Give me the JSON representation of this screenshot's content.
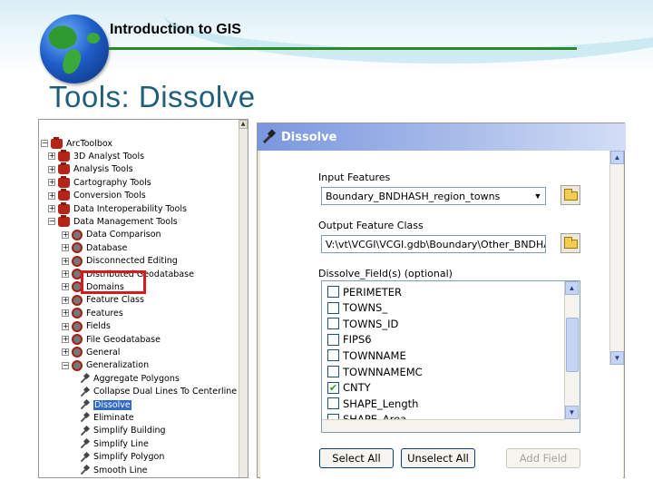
{
  "slide": {
    "course_title": "Introduction to GIS",
    "heading": "Tools: Dissolve"
  },
  "toolbox": {
    "items": [
      {
        "label": "ArcToolbox",
        "expander": "−",
        "icon": "toolbox-root-icon"
      },
      {
        "label": "3D Analyst Tools",
        "expander": "+",
        "icon": "toolbox-icon"
      },
      {
        "label": "Analysis Tools",
        "expander": "+",
        "icon": "toolbox-icon"
      },
      {
        "label": "Cartography Tools",
        "expander": "+",
        "icon": "toolbox-icon"
      },
      {
        "label": "Conversion Tools",
        "expander": "+",
        "icon": "toolbox-icon"
      },
      {
        "label": "Data Interoperability Tools",
        "expander": "+",
        "icon": "toolbox-icon"
      },
      {
        "label": "Data Management Tools",
        "expander": "−",
        "icon": "toolbox-icon"
      },
      {
        "label": "Data Comparison",
        "expander": "+",
        "icon": "toolset-icon"
      },
      {
        "label": "Database",
        "expander": "+",
        "icon": "toolset-icon"
      },
      {
        "label": "Disconnected Editing",
        "expander": "+",
        "icon": "toolset-icon"
      },
      {
        "label": "Distributed Geodatabase",
        "expander": "+",
        "icon": "toolset-icon"
      },
      {
        "label": "Domains",
        "expander": "+",
        "icon": "toolset-icon"
      },
      {
        "label": "Feature Class",
        "expander": "+",
        "icon": "toolset-icon"
      },
      {
        "label": "Features",
        "expander": "+",
        "icon": "toolset-icon"
      },
      {
        "label": "Fields",
        "expander": "+",
        "icon": "toolset-icon"
      },
      {
        "label": "File Geodatabase",
        "expander": "+",
        "icon": "toolset-icon"
      },
      {
        "label": "General",
        "expander": "+",
        "icon": "toolset-icon"
      },
      {
        "label": "Generalization",
        "expander": "−",
        "icon": "toolset-icon"
      },
      {
        "label": "Aggregate Polygons",
        "expander": "",
        "icon": "tool-hammer-icon"
      },
      {
        "label": "Collapse Dual Lines To Centerline",
        "expander": "",
        "icon": "tool-hammer-icon"
      },
      {
        "label": "Dissolve",
        "expander": "",
        "icon": "tool-hammer-icon",
        "selected": true
      },
      {
        "label": "Eliminate",
        "expander": "",
        "icon": "tool-hammer-icon"
      },
      {
        "label": "Simplify Building",
        "expander": "",
        "icon": "tool-hammer-icon"
      },
      {
        "label": "Simplify Line",
        "expander": "",
        "icon": "tool-hammer-icon"
      },
      {
        "label": "Simplify Polygon",
        "expander": "",
        "icon": "tool-hammer-icon"
      },
      {
        "label": "Smooth Line",
        "expander": "",
        "icon": "tool-hammer-icon"
      }
    ]
  },
  "dialog": {
    "title": "Dissolve",
    "input_features_label": "Input Features",
    "input_features_value": "Boundary_BNDHASH_region_towns",
    "output_class_label": "Output Feature Class",
    "output_class_value": "V:\\vt\\VCGI\\VCGI.gdb\\Boundary\\Other_BNDHASH",
    "dissolve_fields_label": "Dissolve_Field(s) (optional)",
    "fields": [
      {
        "name": "PERIMETER",
        "checked": false
      },
      {
        "name": "TOWNS_",
        "checked": false
      },
      {
        "name": "TOWNS_ID",
        "checked": false
      },
      {
        "name": "FIPS6",
        "checked": false
      },
      {
        "name": "TOWNNAME",
        "checked": false
      },
      {
        "name": "TOWNNAMEMC",
        "checked": false
      },
      {
        "name": "CNTY",
        "checked": true
      },
      {
        "name": "SHAPE_Length",
        "checked": false
      },
      {
        "name": "SHAPE_Area",
        "checked": false
      }
    ],
    "select_all": "Select All",
    "unselect_all": "Unselect All",
    "add_field": "Add Field"
  },
  "colors": {
    "heading": "#1f5f7a",
    "rule": "#2a8a2a",
    "highlight_box": "#d61b1b",
    "selection": "#316ac5",
    "dialog_title": "#7a96df"
  }
}
